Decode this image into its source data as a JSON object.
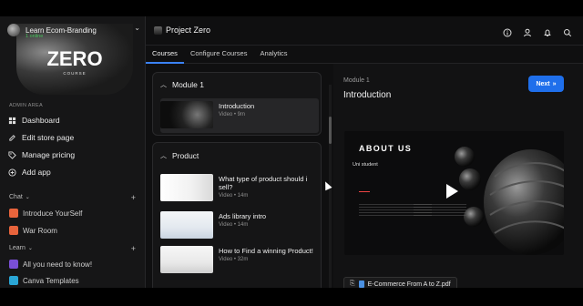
{
  "workspace": {
    "name": "Learn Ecom-Branding",
    "status": "1 online"
  },
  "banner": {
    "title": "ZERO",
    "subtitle": "COURSE"
  },
  "sidebar": {
    "admin_label": "ADMIN AREA",
    "admin_items": [
      {
        "label": "Dashboard",
        "icon": "dashboard-icon"
      },
      {
        "label": "Edit store page",
        "icon": "edit-icon"
      },
      {
        "label": "Manage pricing",
        "icon": "tag-icon"
      },
      {
        "label": "Add app",
        "icon": "plus-circle-icon"
      }
    ],
    "chat_label": "Chat",
    "chat_items": [
      {
        "label": "Introduce YourSelf",
        "color": "#e8643c"
      },
      {
        "label": "War Room",
        "color": "#e8643c"
      }
    ],
    "learn_label": "Learn",
    "learn_items": [
      {
        "label": "All you need to know!",
        "color": "#7a4fd6"
      },
      {
        "label": "Canva Templates",
        "color": "#2aa6d6"
      }
    ]
  },
  "header": {
    "title": "Project Zero"
  },
  "tabs": [
    "Courses",
    "Configure Courses",
    "Analytics"
  ],
  "modules": [
    {
      "title": "Module 1",
      "lessons": [
        {
          "title": "Introduction",
          "meta": "Video • 9m"
        }
      ]
    },
    {
      "title": "Product",
      "lessons": [
        {
          "title": "What type of product should i sell?",
          "meta": "Video • 14m"
        },
        {
          "title": "Ads library intro",
          "meta": "Video • 14m"
        },
        {
          "title": "How to Find a winning Product!",
          "meta": "Video • 32m"
        }
      ]
    }
  ],
  "player": {
    "module_label": "Module 1",
    "lesson_title": "Introduction",
    "next_label": "Next",
    "video_heading": "ABOUT US",
    "video_sub": "Uni student",
    "attachment": "E-Commerce From A to Z.pdf"
  }
}
